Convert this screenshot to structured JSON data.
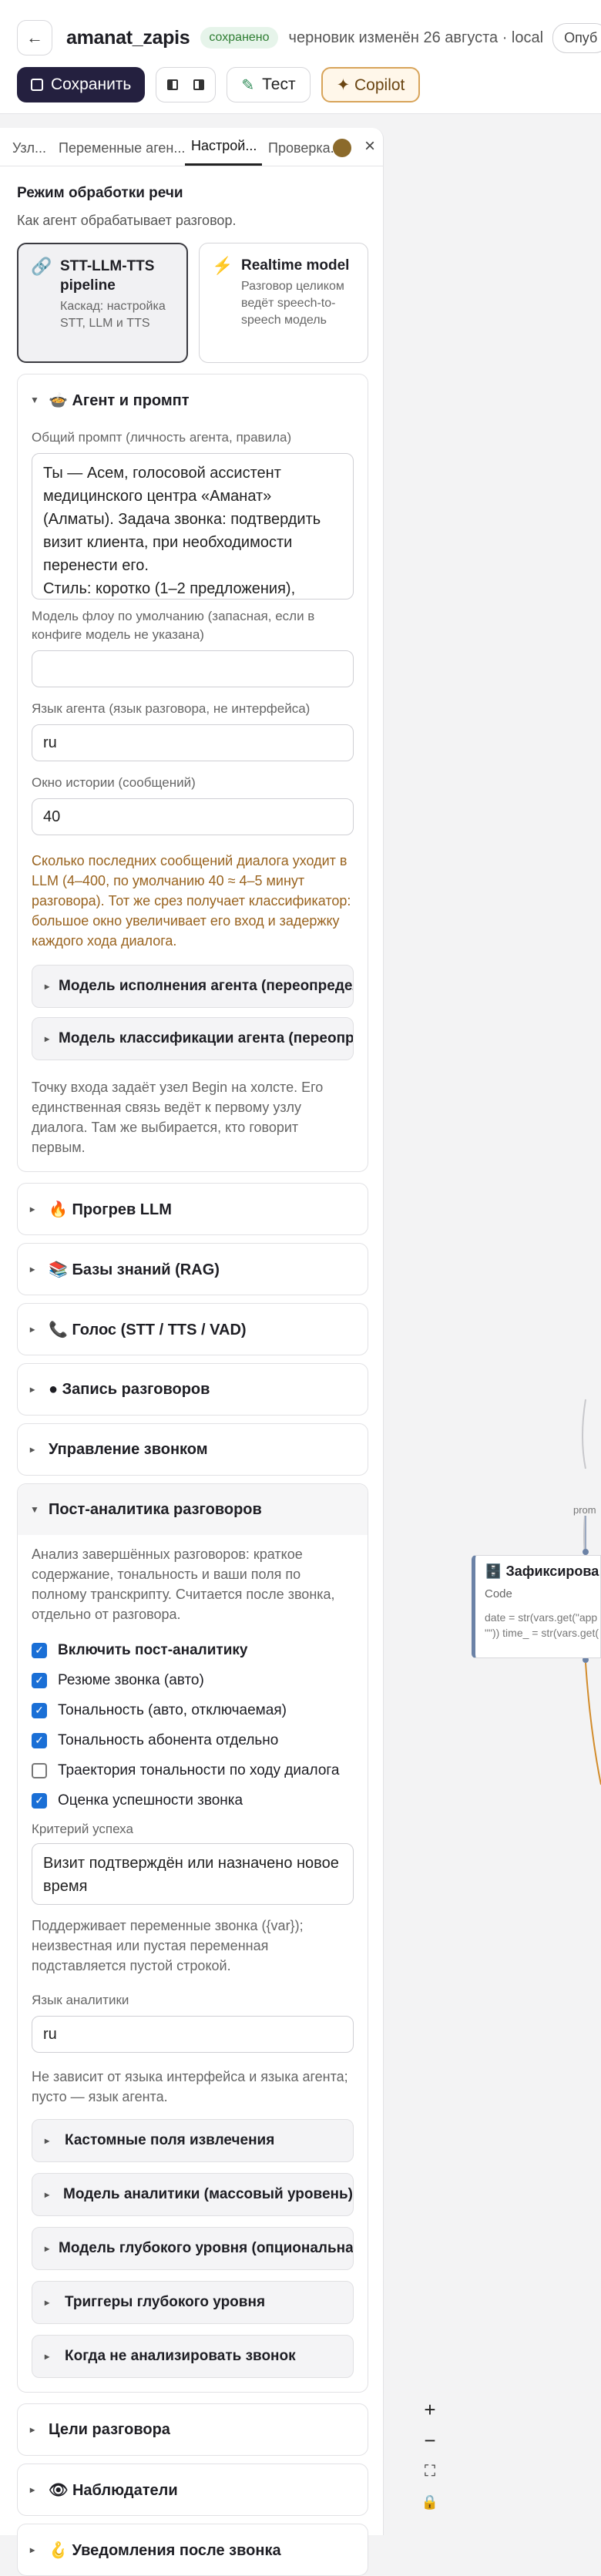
{
  "header": {
    "back_icon": "arrow-left-icon",
    "name": "amanat_zapis",
    "saved": "сохранено",
    "draft": "черновик изменён 26 августа · local",
    "publish": "Опуб"
  },
  "toolbar": {
    "save": "Сохранить",
    "test": "Тест",
    "copilot": "✦ Copilot"
  },
  "tabs": [
    "Узл...",
    "Переменные аген...",
    "Настрой...",
    "Проверка..."
  ],
  "settings": {
    "title": "Режим обработки речи",
    "desc": "Как агент обрабатывает разговор.",
    "modes": [
      {
        "icon": "link-icon",
        "title": "STT-LLM-TTS pipeline",
        "desc": "Каскад: настройка STT, LLM и TTS"
      },
      {
        "icon": "lightning-icon",
        "title": "Realtime model",
        "desc": "Разговор целиком ведёт speech-to-speech модель"
      }
    ],
    "agent": {
      "title": "🍲 Агент и промпт",
      "prompt_label": "Общий промпт (личность агента, правила)",
      "prompt": "Ты — Асем, голосовой ассистент медицинского центра «Аманат» (Алматы). Задача звонка: подтвердить визит клиента, при необходимости перенести его.\nСтиль: коротко (1–2 предложения),",
      "model_label": "Модель флоу по умолчанию (запасная, если в конфиге модель не указана)",
      "model": "",
      "lang_label": "Язык агента (язык разговора, не интерфейса)",
      "lang": "ru",
      "history_label": "Окно истории (сообщений)",
      "history": "40",
      "hint": "Сколько последних сообщений диалога уходит в LLM (4–400, по умолчанию 40 ≈ 4–5 минут разговора). Тот же срез получает классификатор: большое окно увеличивает его вход и задержку каждого хода диалога.",
      "sub1": "Модель исполнения агента (переопределение)",
      "sub2": "Модель классификации агента (переопределение)",
      "entry": "Точку входа задаёт узел Begin на холсте. Его единственная связь ведёт к первому узлу диалога. Там же выбирается, кто говорит первым."
    },
    "sections1": [
      "🔥 Прогрев LLM",
      "📚 Базы знаний (RAG)",
      "📞 Голос (STT / TTS / VAD)",
      "● Запись разговоров",
      "Управление звонком"
    ],
    "post": {
      "title": "Пост-аналитика разговоров",
      "desc": "Анализ завершённых разговоров: краткое содержание, тональность и ваши поля по полному транскрипту. Считается после звонка, отдельно от разговора.",
      "checks": [
        {
          "label": "Включить пост-аналитику",
          "on": true,
          "bold": true
        },
        {
          "label": "Резюме звонка (авто)",
          "on": true
        },
        {
          "label": "Тональность (авто, отключаемая)",
          "on": true
        },
        {
          "label": "Тональность абонента отдельно",
          "on": true
        },
        {
          "label": "Траектория тональности по ходу диалога",
          "on": false
        },
        {
          "label": "Оценка успешности звонка",
          "on": true
        }
      ],
      "crit_label": "Критерий успеха",
      "crit": "Визит подтверждён или назначено новое время",
      "vars_note": "Поддерживает переменные звонка ({var}); неизвестная или пустая переменная подставляется пустой строкой.",
      "lang_label": "Язык аналитики",
      "lang": "ru",
      "lang_note": "Не зависит от языка интерфейса и языка агента; пусто — язык агента.",
      "subs": [
        "Кастомные поля извлечения",
        "Модель аналитики (массовый уровень)",
        "Модель глубокого уровня (опциональная)",
        "Триггеры глубокого уровня",
        "Когда не анализировать звонок"
      ]
    },
    "sections2": [
      "Цели разговора",
      "👁 Наблюдатели",
      "🪝 Уведомления после звонка"
    ]
  },
  "canvas": {
    "edge_label": "prom",
    "node_title": "Зафиксирова",
    "node_kind": "Code",
    "node_code1": "date = str(vars.get(\"app",
    "node_code2": "\"\")) time_ = str(vars.get(",
    "zoom": [
      "+",
      "−",
      "⛶",
      "🔒"
    ]
  }
}
